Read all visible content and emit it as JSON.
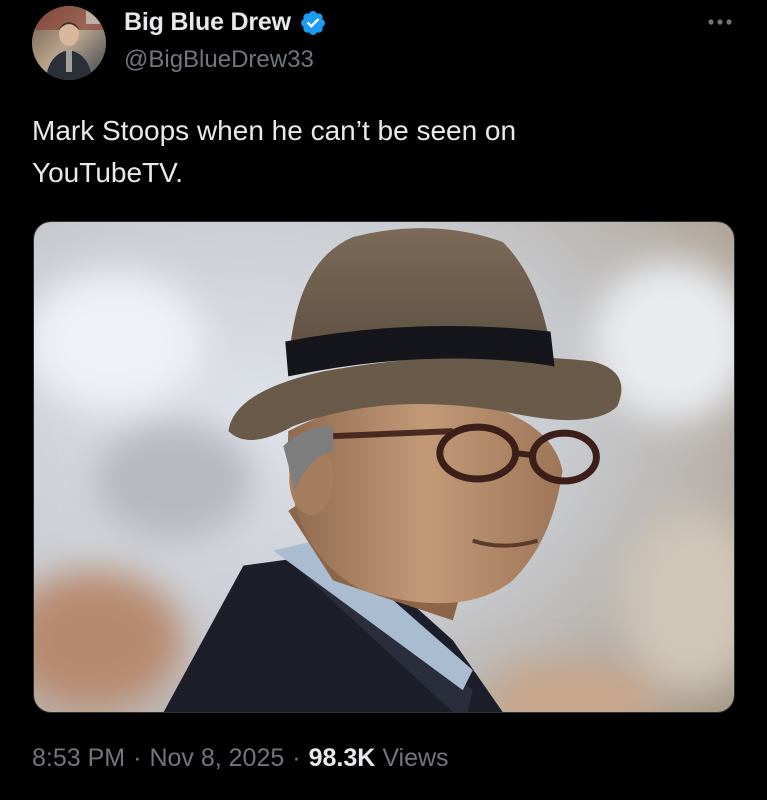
{
  "author": {
    "display_name": "Big Blue Drew",
    "handle": "@BigBlueDrew33",
    "verified": true,
    "avatar_icon": "profile-photo",
    "verified_icon": "verified-badge-icon",
    "verified_color": "#1d9bf0"
  },
  "tweet": {
    "text": "Mark Stoops when he can’t be seen on\nYouTubeTV.",
    "media_description": "photo",
    "time": "8:53 PM",
    "date": "Nov 8, 2025",
    "separator": "·",
    "view_count": "98.3K",
    "views_label": "Views"
  },
  "colors": {
    "background": "#000000",
    "primary_text": "#e7e9ea",
    "secondary_text": "#71767b"
  }
}
